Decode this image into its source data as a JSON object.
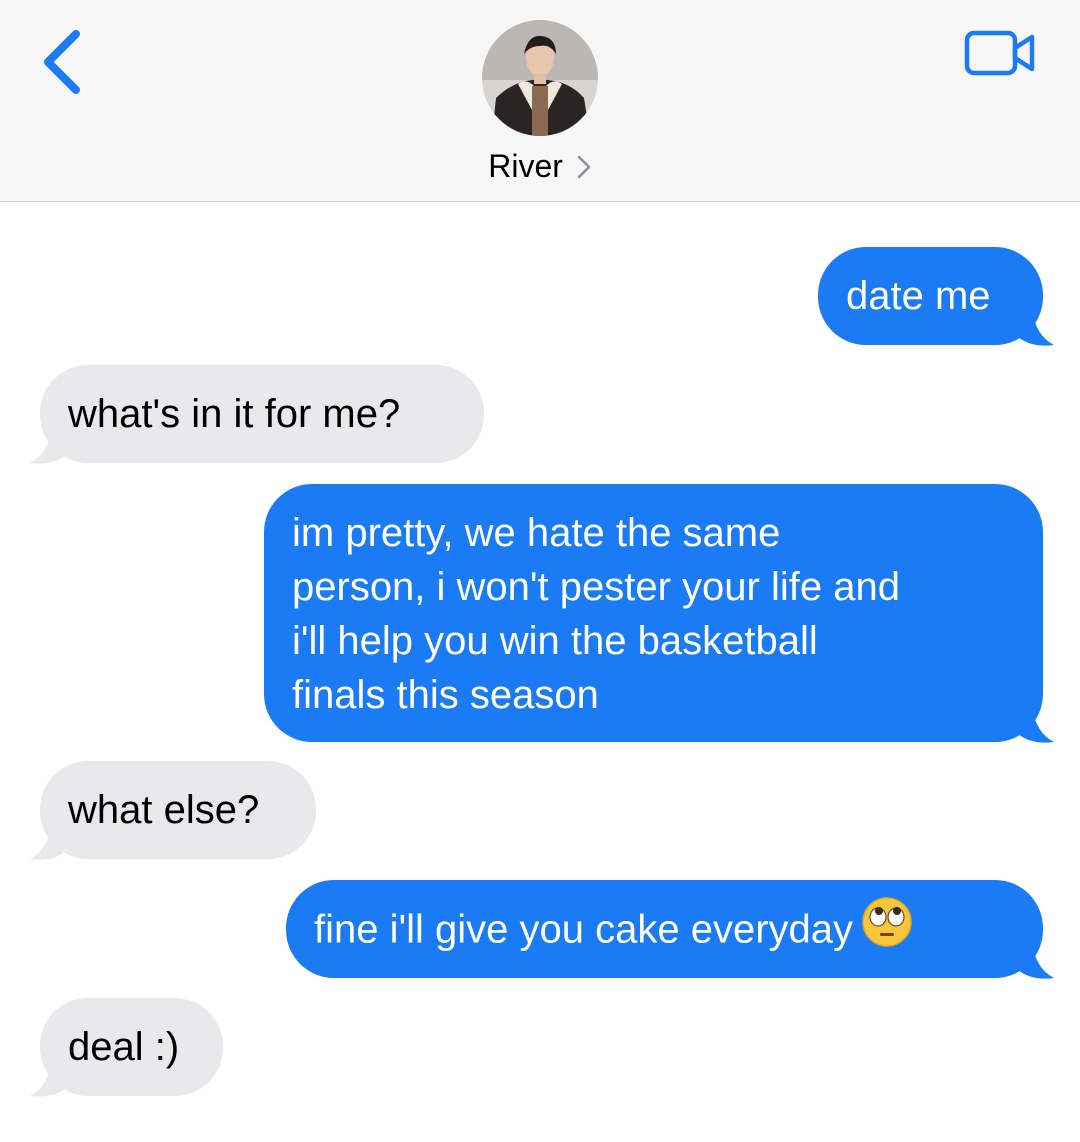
{
  "header": {
    "contact_name": "River",
    "chevron": ">",
    "back_icon": "chevron-left-icon",
    "video_icon": "video-camera-icon",
    "accent": "#1a7bf5"
  },
  "messages": [
    {
      "direction": "sent",
      "text": "date me"
    },
    {
      "direction": "received",
      "text": "what's in it for me?"
    },
    {
      "direction": "sent",
      "lines": [
        "im pretty, we hate the same",
        "person, i won't pester your life and",
        "i'll help you win the basketball",
        "finals this season"
      ]
    },
    {
      "direction": "received",
      "text": "what else?"
    },
    {
      "direction": "sent",
      "text": "fine i'll give you cake everyday",
      "emoji": "face-with-rolling-eyes-icon"
    },
    {
      "direction": "received",
      "text": "deal :)"
    }
  ],
  "colors": {
    "sent_bubble": "#1a7bf5",
    "received_bubble": "#e9e9eb"
  }
}
